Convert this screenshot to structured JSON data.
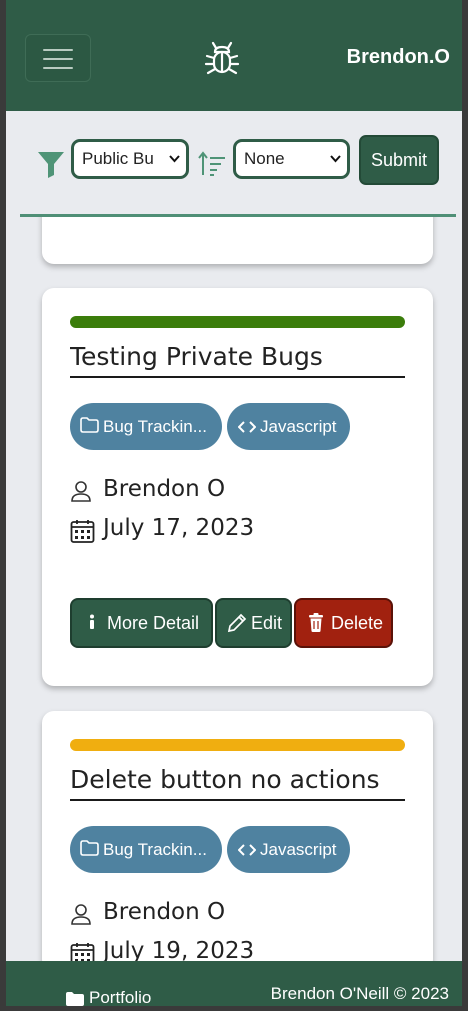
{
  "header": {
    "brand": "Brendon.O",
    "menu_icon": "hamburger-icon",
    "logo_icon": "bug-icon",
    "background": "#2f5c47"
  },
  "filter": {
    "filter_icon": "funnel-icon",
    "visibility_select": {
      "value": "Public Bugs",
      "displayed": "Public Bu"
    },
    "sort_icon": "sort-ascending-icon",
    "sort_select": {
      "value": "None"
    },
    "submit_label": "Submit"
  },
  "cards": [
    {
      "priority_color": "#3b7d0b",
      "title": "Testing Private Bugs",
      "tags": [
        {
          "icon": "folder-icon",
          "label": "Bug Trackin..."
        },
        {
          "icon": "code-icon",
          "label": "Javascript"
        }
      ],
      "author": "Brendon O",
      "date": "July 17, 2023",
      "actions": {
        "details": "More Detail",
        "edit": "Edit",
        "delete": "Delete"
      }
    },
    {
      "priority_color": "#f0ae10",
      "title": "Delete button no actions",
      "tags": [
        {
          "icon": "folder-icon",
          "label": "Bug Trackin..."
        },
        {
          "icon": "code-icon",
          "label": "Javascript"
        }
      ],
      "author": "Brendon O",
      "date": "July 19, 2023"
    }
  ],
  "footer": {
    "link_label": "Portfolio",
    "link_icon": "folder-icon",
    "copyright": "Brendon O'Neill © 2023"
  }
}
